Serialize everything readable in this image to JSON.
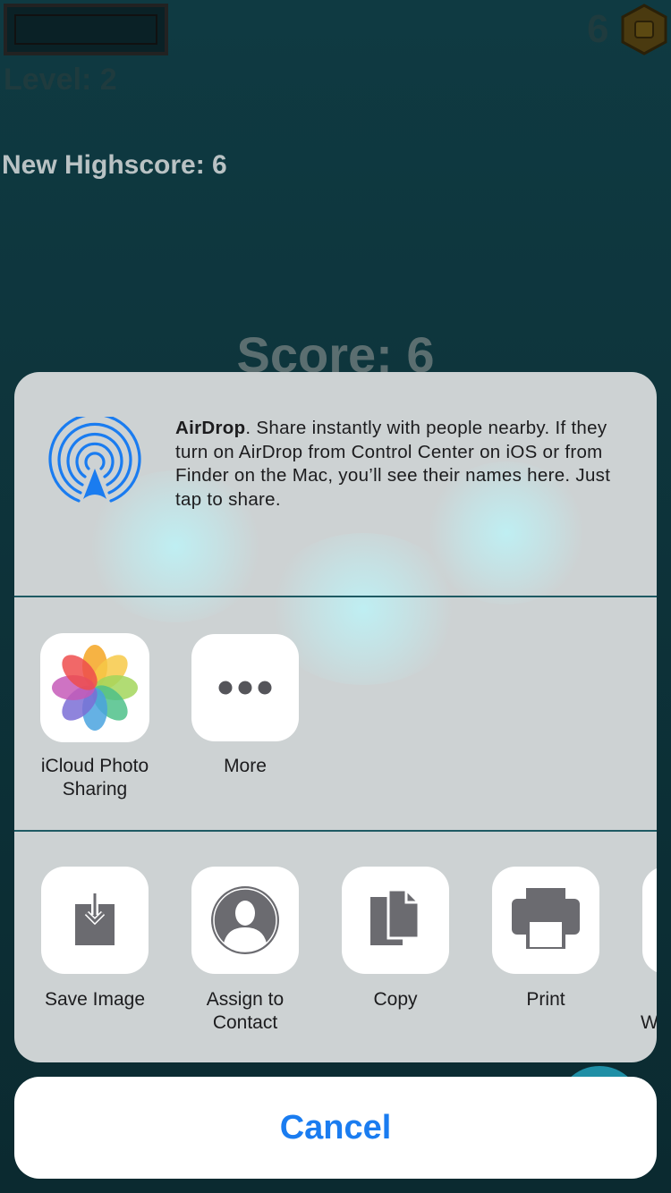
{
  "game": {
    "level_label": "Level: 2",
    "coin_count": "6",
    "highscore_label": "New Highscore: 6",
    "score_label": "Score: 6"
  },
  "share_sheet": {
    "airdrop": {
      "title": "AirDrop",
      "description": ". Share instantly with people nearby. If they turn on AirDrop from Control Center on iOS or from Finder on the Mac, you’ll see their names here. Just tap to share.",
      "icon": "airdrop-icon",
      "color": "#1a7cf0"
    },
    "apps": [
      {
        "label": "iCloud Photo Sharing",
        "icon": "photos-icon"
      },
      {
        "label": "More",
        "icon": "more-icon"
      }
    ],
    "actions": [
      {
        "label": "Save Image",
        "icon": "save-image-icon"
      },
      {
        "label": "Assign to Contact",
        "icon": "contact-icon"
      },
      {
        "label": "Copy",
        "icon": "copy-icon"
      },
      {
        "label": "Print",
        "icon": "print-icon"
      },
      {
        "label": "W",
        "icon": "partial-action-icon"
      }
    ]
  },
  "cancel_label": "Cancel",
  "colors": {
    "accent": "#1a7cf0",
    "sheet_background": "#cdd2d3",
    "icon_gray": "#6b6b70"
  }
}
